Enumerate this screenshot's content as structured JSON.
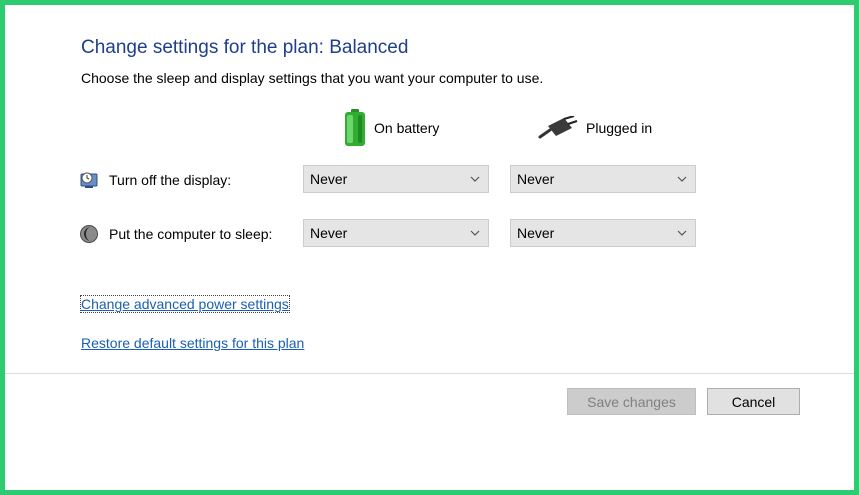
{
  "header": {
    "title": "Change settings for the plan: Balanced",
    "subtitle": "Choose the sleep and display settings that you want your computer to use."
  },
  "columns": {
    "battery_label": "On battery",
    "battery_icon": "battery-icon",
    "plugged_label": "Plugged in",
    "plugged_icon": "power-plug-icon"
  },
  "settings": [
    {
      "label": "Turn off the display:",
      "icon": "display-clock-icon",
      "on_battery": "Never",
      "plugged_in": "Never"
    },
    {
      "label": "Put the computer to sleep:",
      "icon": "sleep-moon-icon",
      "on_battery": "Never",
      "plugged_in": "Never"
    }
  ],
  "links": {
    "advanced": "Change advanced power settings",
    "restore": "Restore default settings for this plan"
  },
  "buttons": {
    "save": "Save changes",
    "cancel": "Cancel"
  },
  "colors": {
    "accent_border": "#2ecc71",
    "title": "#1e3f8a",
    "link": "#1a5fb4"
  }
}
